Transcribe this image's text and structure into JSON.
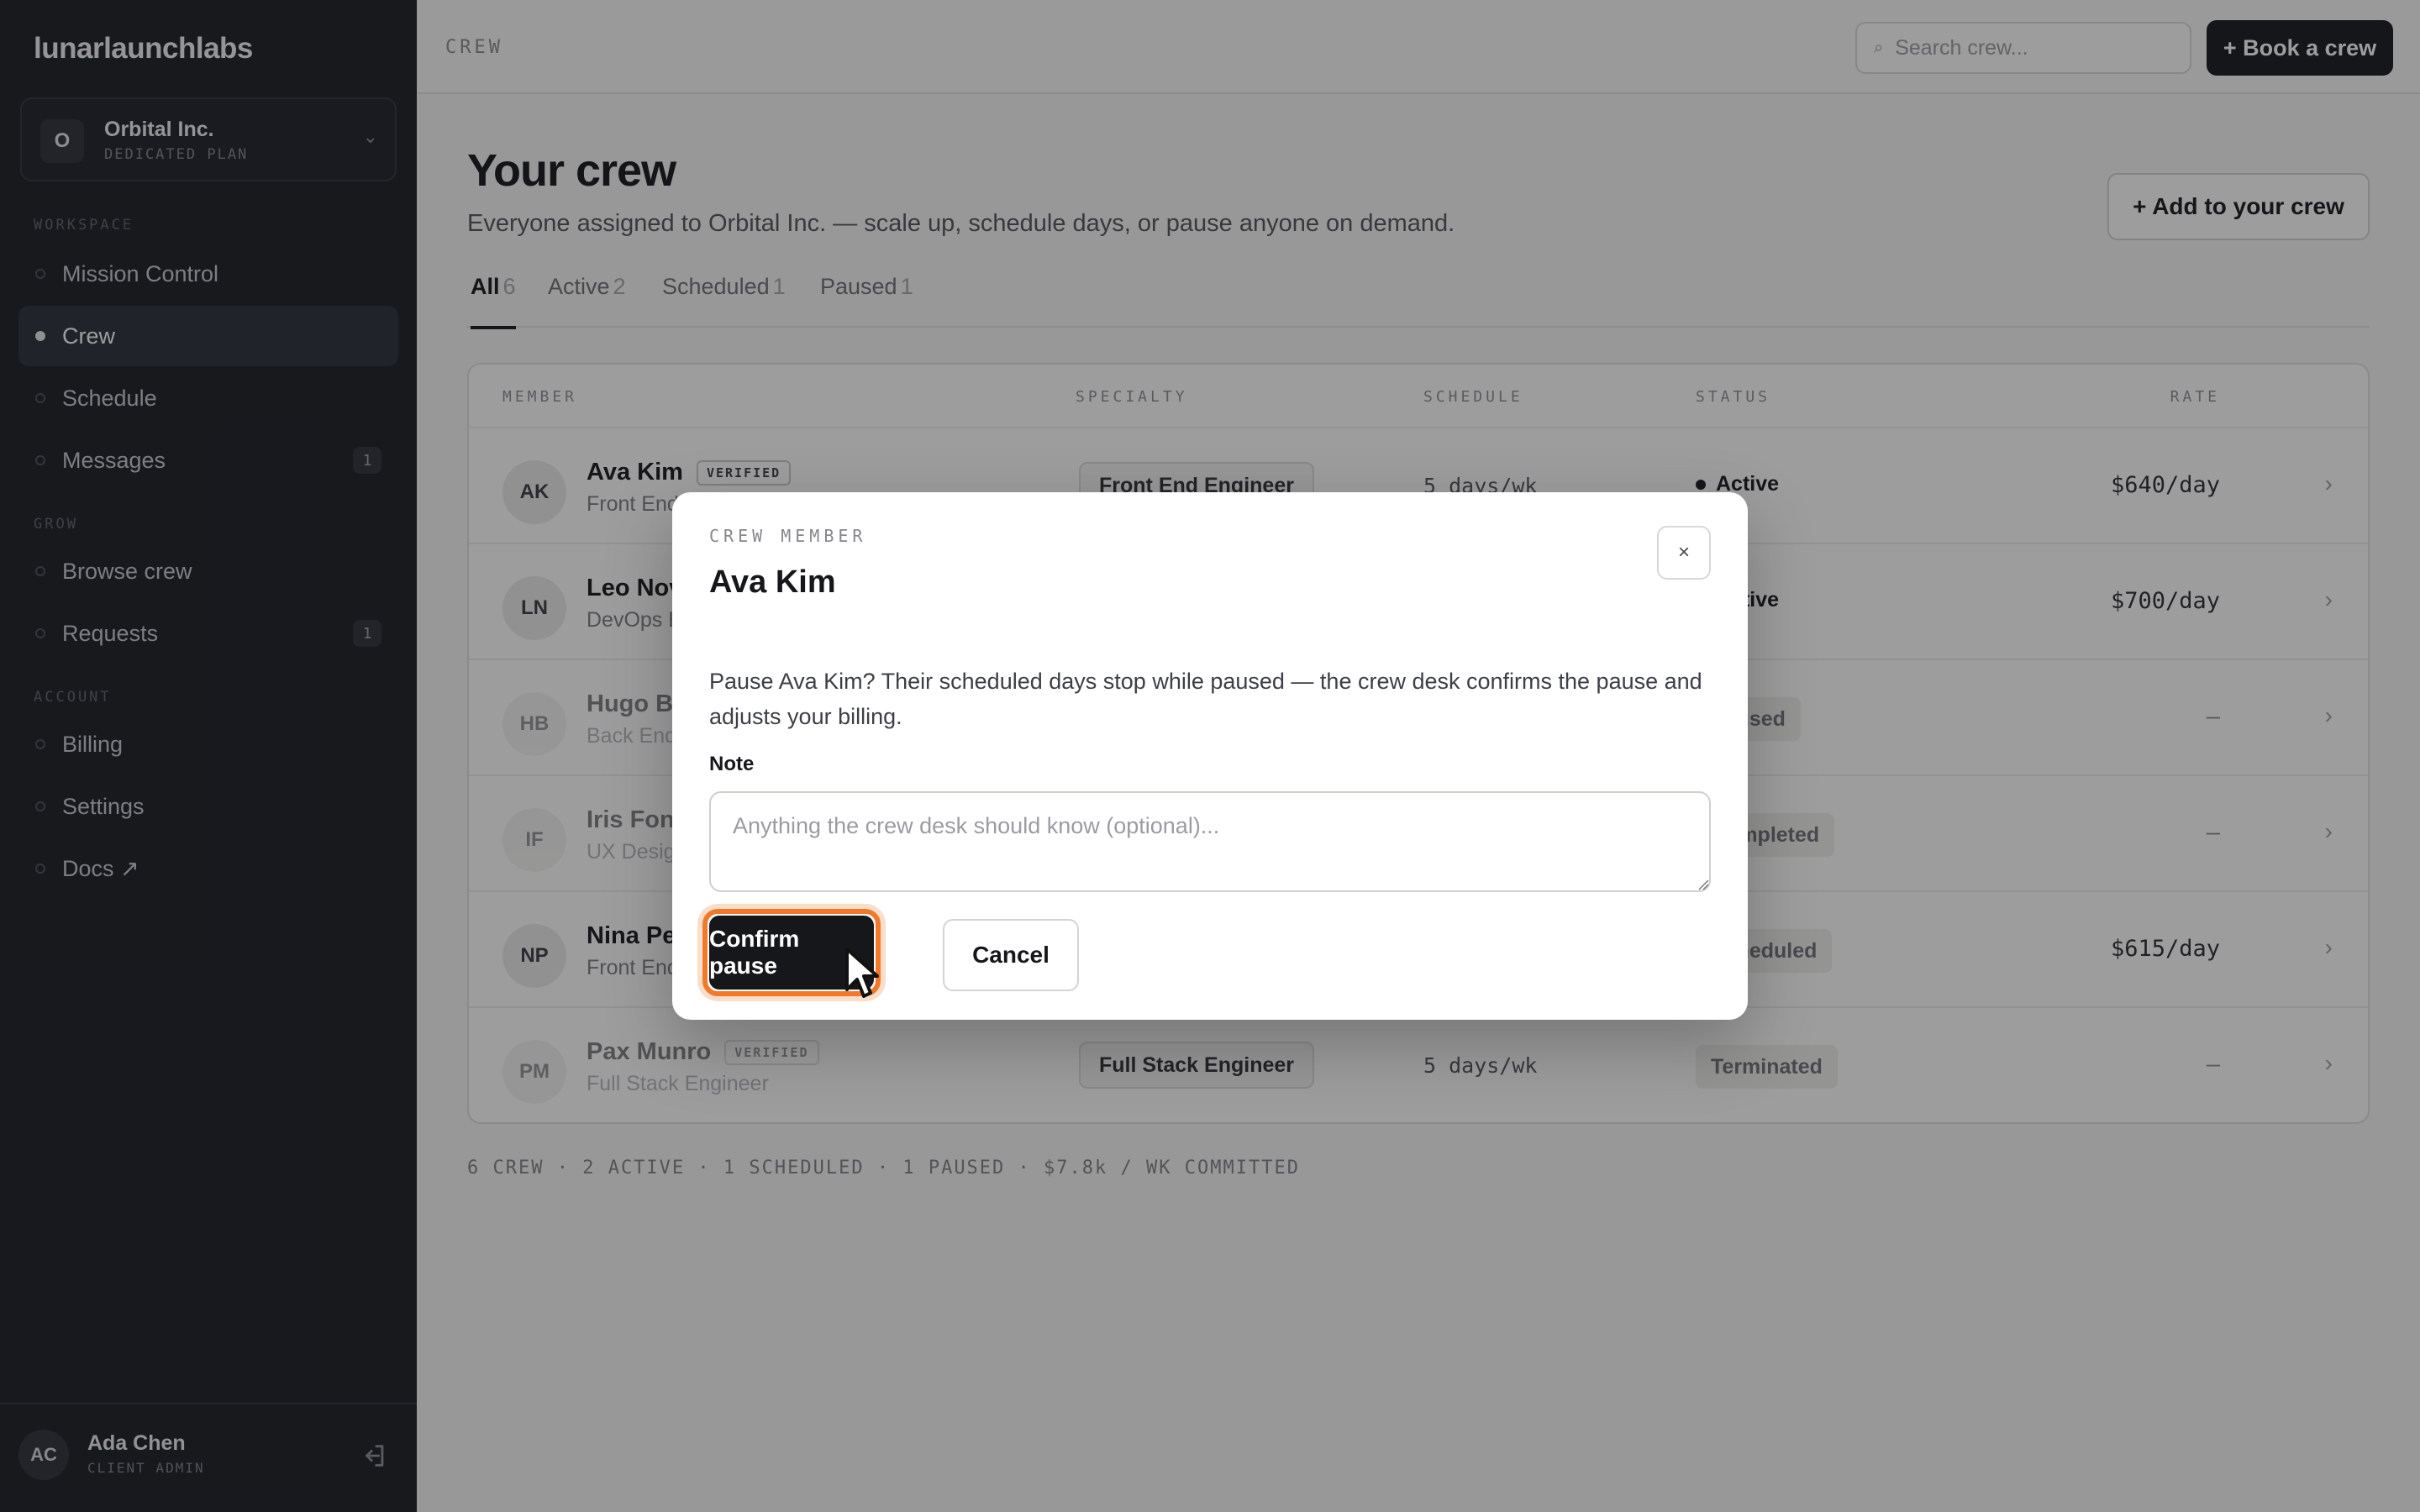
{
  "brand": "lunarlaunchlabs",
  "org": {
    "badge": "O",
    "name": "Orbital Inc.",
    "plan": "DEDICATED PLAN"
  },
  "nav": {
    "workspace_label": "WORKSPACE",
    "grow_label": "GROW",
    "account_label": "ACCOUNT",
    "items": [
      {
        "label": "Mission Control"
      },
      {
        "label": "Crew",
        "active": true
      },
      {
        "label": "Schedule"
      },
      {
        "label": "Messages",
        "count": "1"
      },
      {
        "label": "Browse crew"
      },
      {
        "label": "Requests",
        "count": "1"
      },
      {
        "label": "Billing"
      },
      {
        "label": "Settings"
      },
      {
        "label": "Docs ↗"
      }
    ]
  },
  "user": {
    "initials": "AC",
    "name": "Ada Chen",
    "role": "CLIENT ADMIN"
  },
  "topbar": {
    "crumb": "CREW",
    "search_placeholder": "Search crew...",
    "book_label": "+ Book a crew"
  },
  "page": {
    "title": "Your crew",
    "subtitle": "Everyone assigned to Orbital Inc. — scale up, schedule days, or pause anyone on demand.",
    "add_label": "+ Add to your crew"
  },
  "tabs": [
    {
      "label": "All",
      "count": "6"
    },
    {
      "label": "Active",
      "count": "2"
    },
    {
      "label": "Scheduled",
      "count": "1"
    },
    {
      "label": "Paused",
      "count": "1"
    }
  ],
  "table": {
    "headers": {
      "member": "MEMBER",
      "specialty": "SPECIALTY",
      "schedule": "SCHEDULE",
      "status": "STATUS",
      "rate": "RATE"
    },
    "rows": [
      {
        "initials": "AK",
        "name": "Ava Kim",
        "verified": "VERIFIED",
        "role": "Front End Engineer",
        "specialty": "Front End Engineer",
        "schedule": "5 days/wk",
        "status": "Active",
        "rate": "$640/day"
      },
      {
        "initials": "LN",
        "name": "Leo Nov",
        "role": "DevOps E",
        "status": "Active",
        "rate": "$700/day"
      },
      {
        "initials": "HB",
        "name": "Hugo Br",
        "role": "Back End",
        "status": "Paused",
        "rate": "—"
      },
      {
        "initials": "IF",
        "name": "Iris Fon",
        "role": "UX Desig",
        "status": "Completed",
        "rate": "—"
      },
      {
        "initials": "NP",
        "name": "Nina Pe",
        "role": "Front End",
        "status": "Scheduled",
        "rate": "$615/day"
      },
      {
        "initials": "PM",
        "name": "Pax Munro",
        "verified": "VERIFIED",
        "role": "Full Stack Engineer",
        "specialty": "Full Stack Engineer",
        "schedule": "5 days/wk",
        "status": "Terminated",
        "rate": "—"
      }
    ],
    "chevron": "›"
  },
  "footer_stats": "6 CREW · 2 ACTIVE · 1 SCHEDULED · 1 PAUSED · $7.8k / WK COMMITTED",
  "modal": {
    "eyebrow": "CREW MEMBER",
    "title": "Ava Kim",
    "close": "×",
    "body": "Pause Ava Kim? Their scheduled days stop while paused — the crew desk confirms the pause and adjusts your billing.",
    "note_label": "Note",
    "note_placeholder": "Anything the crew desk should know (optional)...",
    "confirm_label": "Confirm pause",
    "cancel_label": "Cancel"
  },
  "colors": {
    "accent_focus": "#f07a2a",
    "sidebar_bg": "#1a1c22",
    "primary_btn": "#16171a"
  },
  "icons": {
    "search": "search-icon",
    "chevron": "chevron-down-icon",
    "logout": "logout-icon",
    "close": "close-icon"
  }
}
